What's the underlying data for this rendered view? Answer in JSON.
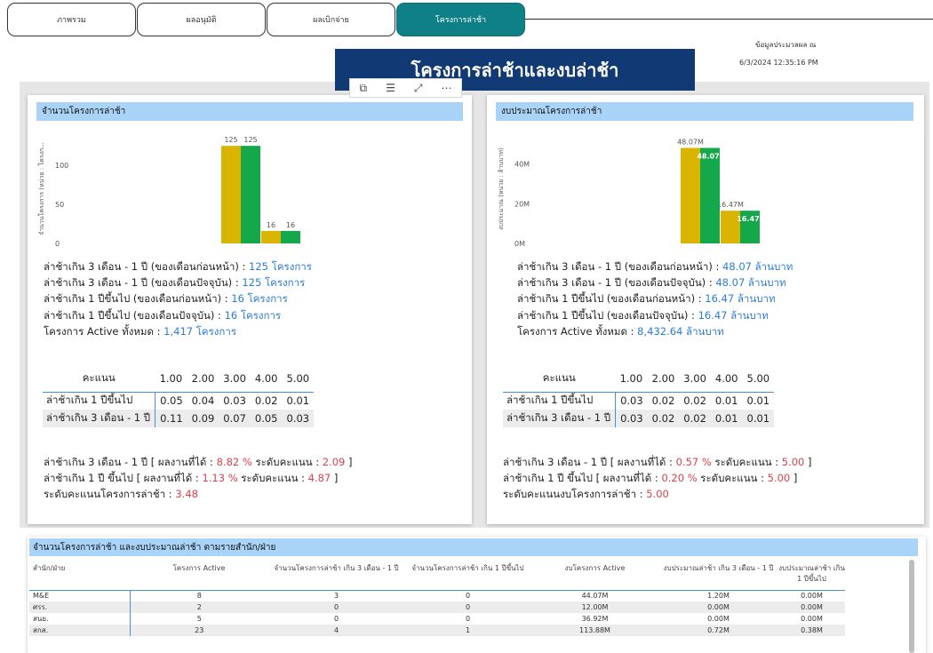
{
  "tabs": [
    {
      "label": "ภาพรวม",
      "active": false
    },
    {
      "label": "ผลอนุมัติ",
      "active": false
    },
    {
      "label": "ผลเบิกจ่าย",
      "active": false
    },
    {
      "label": "โครงการล่าช้า",
      "active": true
    }
  ],
  "info": {
    "label": "ข้อมูลประมวลผล ณ",
    "datetime": "6/3/2024 12:35:16 PM"
  },
  "page_title": "โครงการล่าช้าและงบล่าช้า",
  "toolbar_icons": [
    "copy-icon",
    "filter-icon",
    "focus-mode-icon",
    "more-options-icon"
  ],
  "colors": {
    "yellow": "#d9b400",
    "green": "#15a84a",
    "accent_blue": "#2b7bd8",
    "accent_red": "#d9434e",
    "header": "#a9d3f7",
    "banner": "#113a74",
    "tab_active": "#0e8086"
  },
  "left_card": {
    "title": "จำนวนโครงการล่าช้า",
    "lines": [
      {
        "label": "ล่าช้าเกิน 3 เดือน - 1 ปี (ของเดือนก่อนหน้า) : ",
        "value": "125 โครงการ"
      },
      {
        "label": "ล่าช้าเกิน 3 เดือน - 1 ปี (ของเดือนปัจจุบัน) :  ",
        "value": "125 โครงการ"
      },
      {
        "label": "ล่าช้าเกิน 1 ปีขึ้นไป (ของเดือนก่อนหน้า) : ",
        "value": "16 โครงการ"
      },
      {
        "label": "ล่าช้าเกิน 1 ปีขึ้นไป (ของเดือนปัจจุบัน) :  ",
        "value": "16 โครงการ"
      },
      {
        "label": "โครงการ Active ทั้งหมด :  ",
        "value": "1,417 โครงการ"
      }
    ],
    "score_table": {
      "header": [
        "คะแนน",
        "1.00",
        "2.00",
        "3.00",
        "4.00",
        "5.00"
      ],
      "rows": [
        [
          "ล่าช้าเกิน 1 ปีขึ้นไป",
          "0.05",
          "0.04",
          "0.03",
          "0.02",
          "0.01"
        ],
        [
          "ล่าช้าเกิน 3 เดือน - 1 ปี",
          "0.11",
          "0.09",
          "0.07",
          "0.05",
          "0.03"
        ]
      ]
    },
    "bottom": [
      {
        "label": "ล่าช้าเกิน 3 เดือน - 1 ปี [ ผลงานที่ได้ : ",
        "v1": " 8.82 %",
        "mid": "  ระดับคะแนน : ",
        "v2": "2.09",
        "end": " ]"
      },
      {
        "label": "ล่าช้าเกิน 1 ปี ขึ้นไป [ ผลงานที่ได้ : ",
        "v1": " 1.13 %",
        "mid": "  ระดับคะแนน : ",
        "v2": "4.87",
        "end": " ]"
      }
    ],
    "level_label": "ระดับคะแนนโครงการล่าช้า : ",
    "level_value": "3.48"
  },
  "right_card": {
    "title": "งบประมาณโครงการล่าช้า",
    "lines": [
      {
        "label": "ล่าช้าเกิน 3 เดือน - 1 ปี (ของเดือนก่อนหน้า) : ",
        "value": "48.07 ล้านบาท"
      },
      {
        "label": "ล่าช้าเกิน 3 เดือน - 1 ปี (ของเดือนปัจจุบัน) :  ",
        "value": "48.07  ล้านบาท"
      },
      {
        "label": "ล่าช้าเกิน 1 ปีขึ้นไป (ของเดือนก่อนหน้า) : ",
        "value": "16.47 ล้านบาท"
      },
      {
        "label": "ล่าช้าเกิน 1 ปีขึ้นไป (ของเดือนปัจจุบัน) :  ",
        "value": "16.47  ล้านบาท"
      },
      {
        "label": "โครงการ Active ทั้งหมด : ",
        "value": "8,432.64 ล้านบาท"
      }
    ],
    "score_table": {
      "header": [
        "คะแนน",
        "1.00",
        "2.00",
        "3.00",
        "4.00",
        "5.00"
      ],
      "rows": [
        [
          "ล่าช้าเกิน 1 ปีขึ้นไป",
          "0.03",
          "0.02",
          "0.02",
          "0.01",
          "0.01"
        ],
        [
          "ล่าช้าเกิน 3 เดือน - 1 ปี",
          "0.03",
          "0.02",
          "0.02",
          "0.01",
          "0.01"
        ]
      ]
    },
    "bottom": [
      {
        "label": "ล่าช้าเกิน 3 เดือน - 1 ปี [ ผลงานที่ได้ : ",
        "v1": " 0.57 %",
        "mid": "  ระดับคะแนน : ",
        "v2": "5.00",
        "end": " ]"
      },
      {
        "label": "ล่าช้าเกิน 1 ปี ขึ้นไป [ ผลงานที่ได้ : ",
        "v1": " 0.20 %",
        "mid": "  ระดับคะแนน : ",
        "v2": "5.00",
        "end": " ]"
      }
    ],
    "level_label": "ระดับคะแนนงบโครงการล่าช้า : ",
    "level_value": "5.00"
  },
  "chart_data": [
    {
      "type": "bar",
      "ylabel": "จำนวนโครงการ (หน่วย : โครงก...",
      "yticks": [
        0,
        50,
        100
      ],
      "ylim": [
        0,
        140
      ],
      "series": [
        {
          "name": "",
          "color": "#d9b400",
          "values": [
            125,
            16
          ]
        },
        {
          "name": "",
          "color": "#15a84a",
          "values": [
            125,
            16
          ]
        }
      ],
      "data_labels": [
        "125",
        "125",
        "16",
        "16"
      ]
    },
    {
      "type": "bar",
      "ylabel": "งบประมาณ (หน่วย : ล้านบาท)",
      "ytick_labels": [
        "0M",
        "20M",
        "40M"
      ],
      "yticks": [
        0,
        20,
        40
      ],
      "ylim": [
        0,
        55
      ],
      "series": [
        {
          "name": "",
          "color": "#d9b400",
          "values": [
            48.07,
            16.47
          ]
        },
        {
          "name": "",
          "color": "#15a84a",
          "values": [
            48.07,
            16.47
          ]
        }
      ],
      "data_labels": [
        "48.07M",
        "48.07M",
        "16.47M",
        "16.47M"
      ]
    }
  ],
  "dept_table": {
    "title": "จำนวนโครงการล่าช้า และงบประมาณล่าช้า ตามรายสำนัก/ฝ่าย",
    "headers": [
      "สำนัก/ฝ่าย",
      "โครงการ Active",
      "จำนวนโครงการล่าช้า เกิน 3 เดือน - 1 ปี",
      "จำนวนโครงการล่าช้า เกิน 1 ปีขึ้นไป",
      "งบโครงการ Active",
      "งบประมาณล่าช้า เกิน 3 เดือน - 1 ปี",
      "งบประมาณล่าช้า เกิน 1 ปีขึ้นไป"
    ],
    "rows": [
      [
        "M&E",
        "8",
        "3",
        "0",
        "44.07M",
        "1.20M",
        "0.00M"
      ],
      [
        "ศรร.",
        "2",
        "0",
        "0",
        "12.00M",
        "0.00M",
        "0.00M"
      ],
      [
        "สนย.",
        "5",
        "0",
        "0",
        "36.92M",
        "0.00M",
        "0.00M"
      ],
      [
        "สกส.",
        "23",
        "4",
        "1",
        "113.88M",
        "0.72M",
        "0.38M"
      ]
    ]
  }
}
